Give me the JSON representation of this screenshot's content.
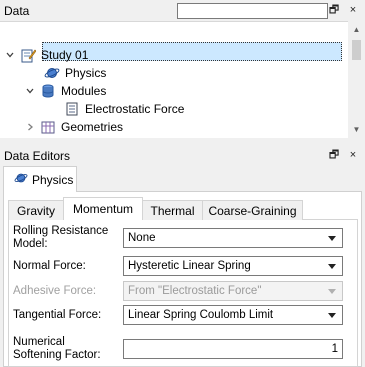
{
  "data_panel": {
    "title": "Data",
    "search": {
      "value": "",
      "placeholder": ""
    },
    "buttons": {
      "float": "🗗",
      "close": "×"
    },
    "tree": [
      {
        "label": "Study 01",
        "icon": "study-icon",
        "expanded": true
      },
      {
        "label": "Physics",
        "icon": "physics-icon",
        "selected": true
      },
      {
        "label": "Modules",
        "icon": "modules-icon",
        "expanded": true
      },
      {
        "label": "Electrostatic Force",
        "icon": "document-icon"
      },
      {
        "label": "Geometries",
        "icon": "geometries-icon",
        "expanded": false
      }
    ]
  },
  "editors_panel": {
    "title": "Data Editors",
    "buttons": {
      "float": "🗗",
      "close": "×"
    },
    "outer_tab": "Physics",
    "tabs": [
      {
        "label": "Gravity",
        "active": false
      },
      {
        "label": "Momentum",
        "active": true
      },
      {
        "label": "Thermal",
        "active": false
      },
      {
        "label": "Coarse-Graining",
        "active": false
      }
    ],
    "fields": {
      "rolling_resistance": {
        "label": "Rolling Resistance Model:",
        "value": "None"
      },
      "normal_force": {
        "label": "Normal Force:",
        "value": "Hysteretic Linear Spring"
      },
      "adhesive_force": {
        "label": "Adhesive Force:",
        "value": "From \"Electrostatic Force\"",
        "disabled": true
      },
      "tangential_force": {
        "label": "Tangential Force:",
        "value": "Linear Spring Coulomb Limit"
      },
      "numerical_softening": {
        "label": "Numerical Softening Factor:",
        "value": "1"
      }
    }
  },
  "colors": {
    "selection": "#cce8ff",
    "panel_bg": "#f0f0f0",
    "border": "#d0d0d0"
  }
}
